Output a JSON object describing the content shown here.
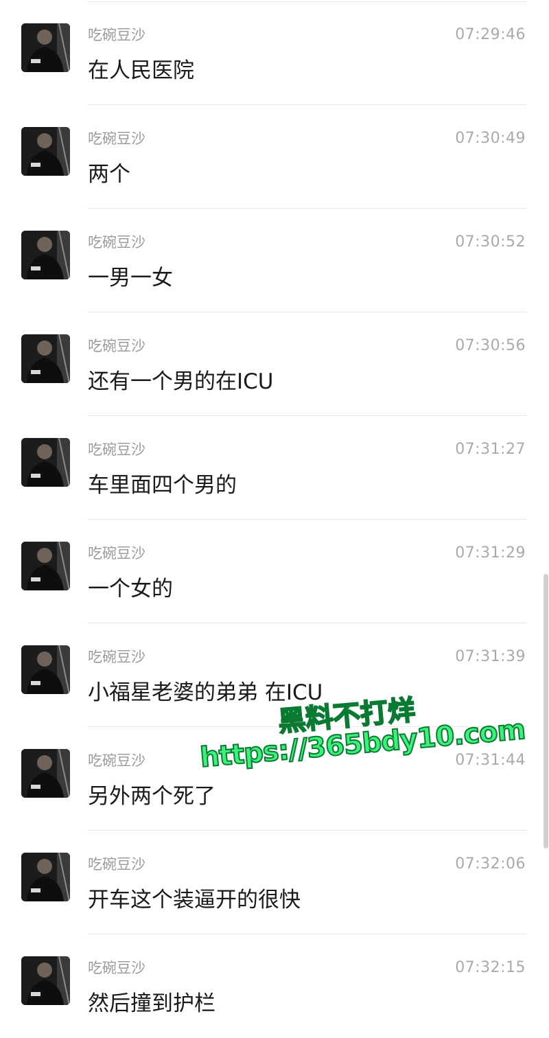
{
  "messages": [
    {
      "sender": "吃碗豆沙",
      "time": "07:29:46",
      "text": "在人民医院"
    },
    {
      "sender": "吃碗豆沙",
      "time": "07:30:49",
      "text": "两个"
    },
    {
      "sender": "吃碗豆沙",
      "time": "07:30:52",
      "text": "一男一女"
    },
    {
      "sender": "吃碗豆沙",
      "time": "07:30:56",
      "text": "还有一个男的在ICU"
    },
    {
      "sender": "吃碗豆沙",
      "time": "07:31:27",
      "text": "车里面四个男的"
    },
    {
      "sender": "吃碗豆沙",
      "time": "07:31:29",
      "text": "一个女的"
    },
    {
      "sender": "吃碗豆沙",
      "time": "07:31:39",
      "text": "小福星老婆的弟弟 在ICU"
    },
    {
      "sender": "吃碗豆沙",
      "time": "07:31:44",
      "text": "另外两个死了"
    },
    {
      "sender": "吃碗豆沙",
      "time": "07:32:06",
      "text": "开车这个装逼开的很快"
    },
    {
      "sender": "吃碗豆沙",
      "time": "07:32:15",
      "text": "然后撞到护栏"
    }
  ],
  "watermark": {
    "line1": "黑料不打烊",
    "line2": "https://365bdy10.com"
  },
  "colors": {
    "sender": "#9b9b9b",
    "time": "#a9a9a9",
    "text": "#1a1a1a",
    "divider": "#e9e9e9",
    "watermark_fill": "#3cf07a",
    "watermark_stroke": "#0a7a33"
  }
}
